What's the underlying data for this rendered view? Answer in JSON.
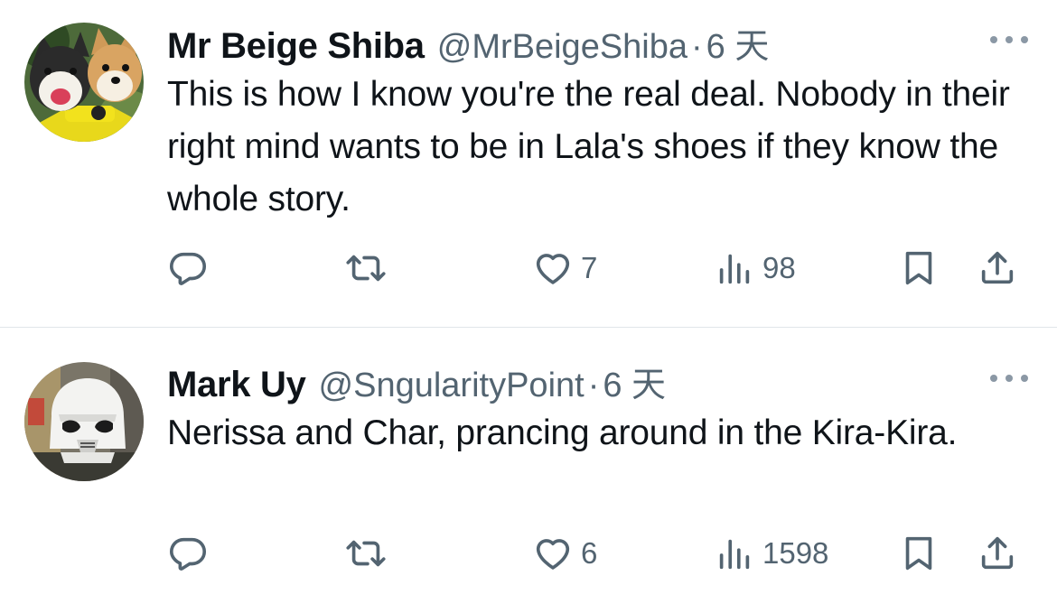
{
  "tweets": [
    {
      "author_name": "Mr Beige Shiba",
      "handle": "@MrBeigeShiba",
      "separator": "·",
      "time": "6 天",
      "text": "This is how I know you're the real deal. Nobody in their right mind wants to be in Lala's shoes if they know the whole story.",
      "likes": "7",
      "views": "98"
    },
    {
      "author_name": "Mark Uy",
      "handle": "@SngularityPoint",
      "separator": "·",
      "time": "6 天",
      "text": "Nerissa and Char, prancing around in the Kira-Kira.",
      "likes": "6",
      "views": "1598"
    }
  ],
  "icons": {
    "reply": "reply-icon",
    "retweet": "retweet-icon",
    "like": "heart-icon",
    "views": "views-icon",
    "bookmark": "bookmark-icon",
    "share": "share-icon",
    "more": "more-icon"
  },
  "colors": {
    "text": "#0f1419",
    "secondary": "#536471",
    "divider": "#e1e6ea"
  }
}
